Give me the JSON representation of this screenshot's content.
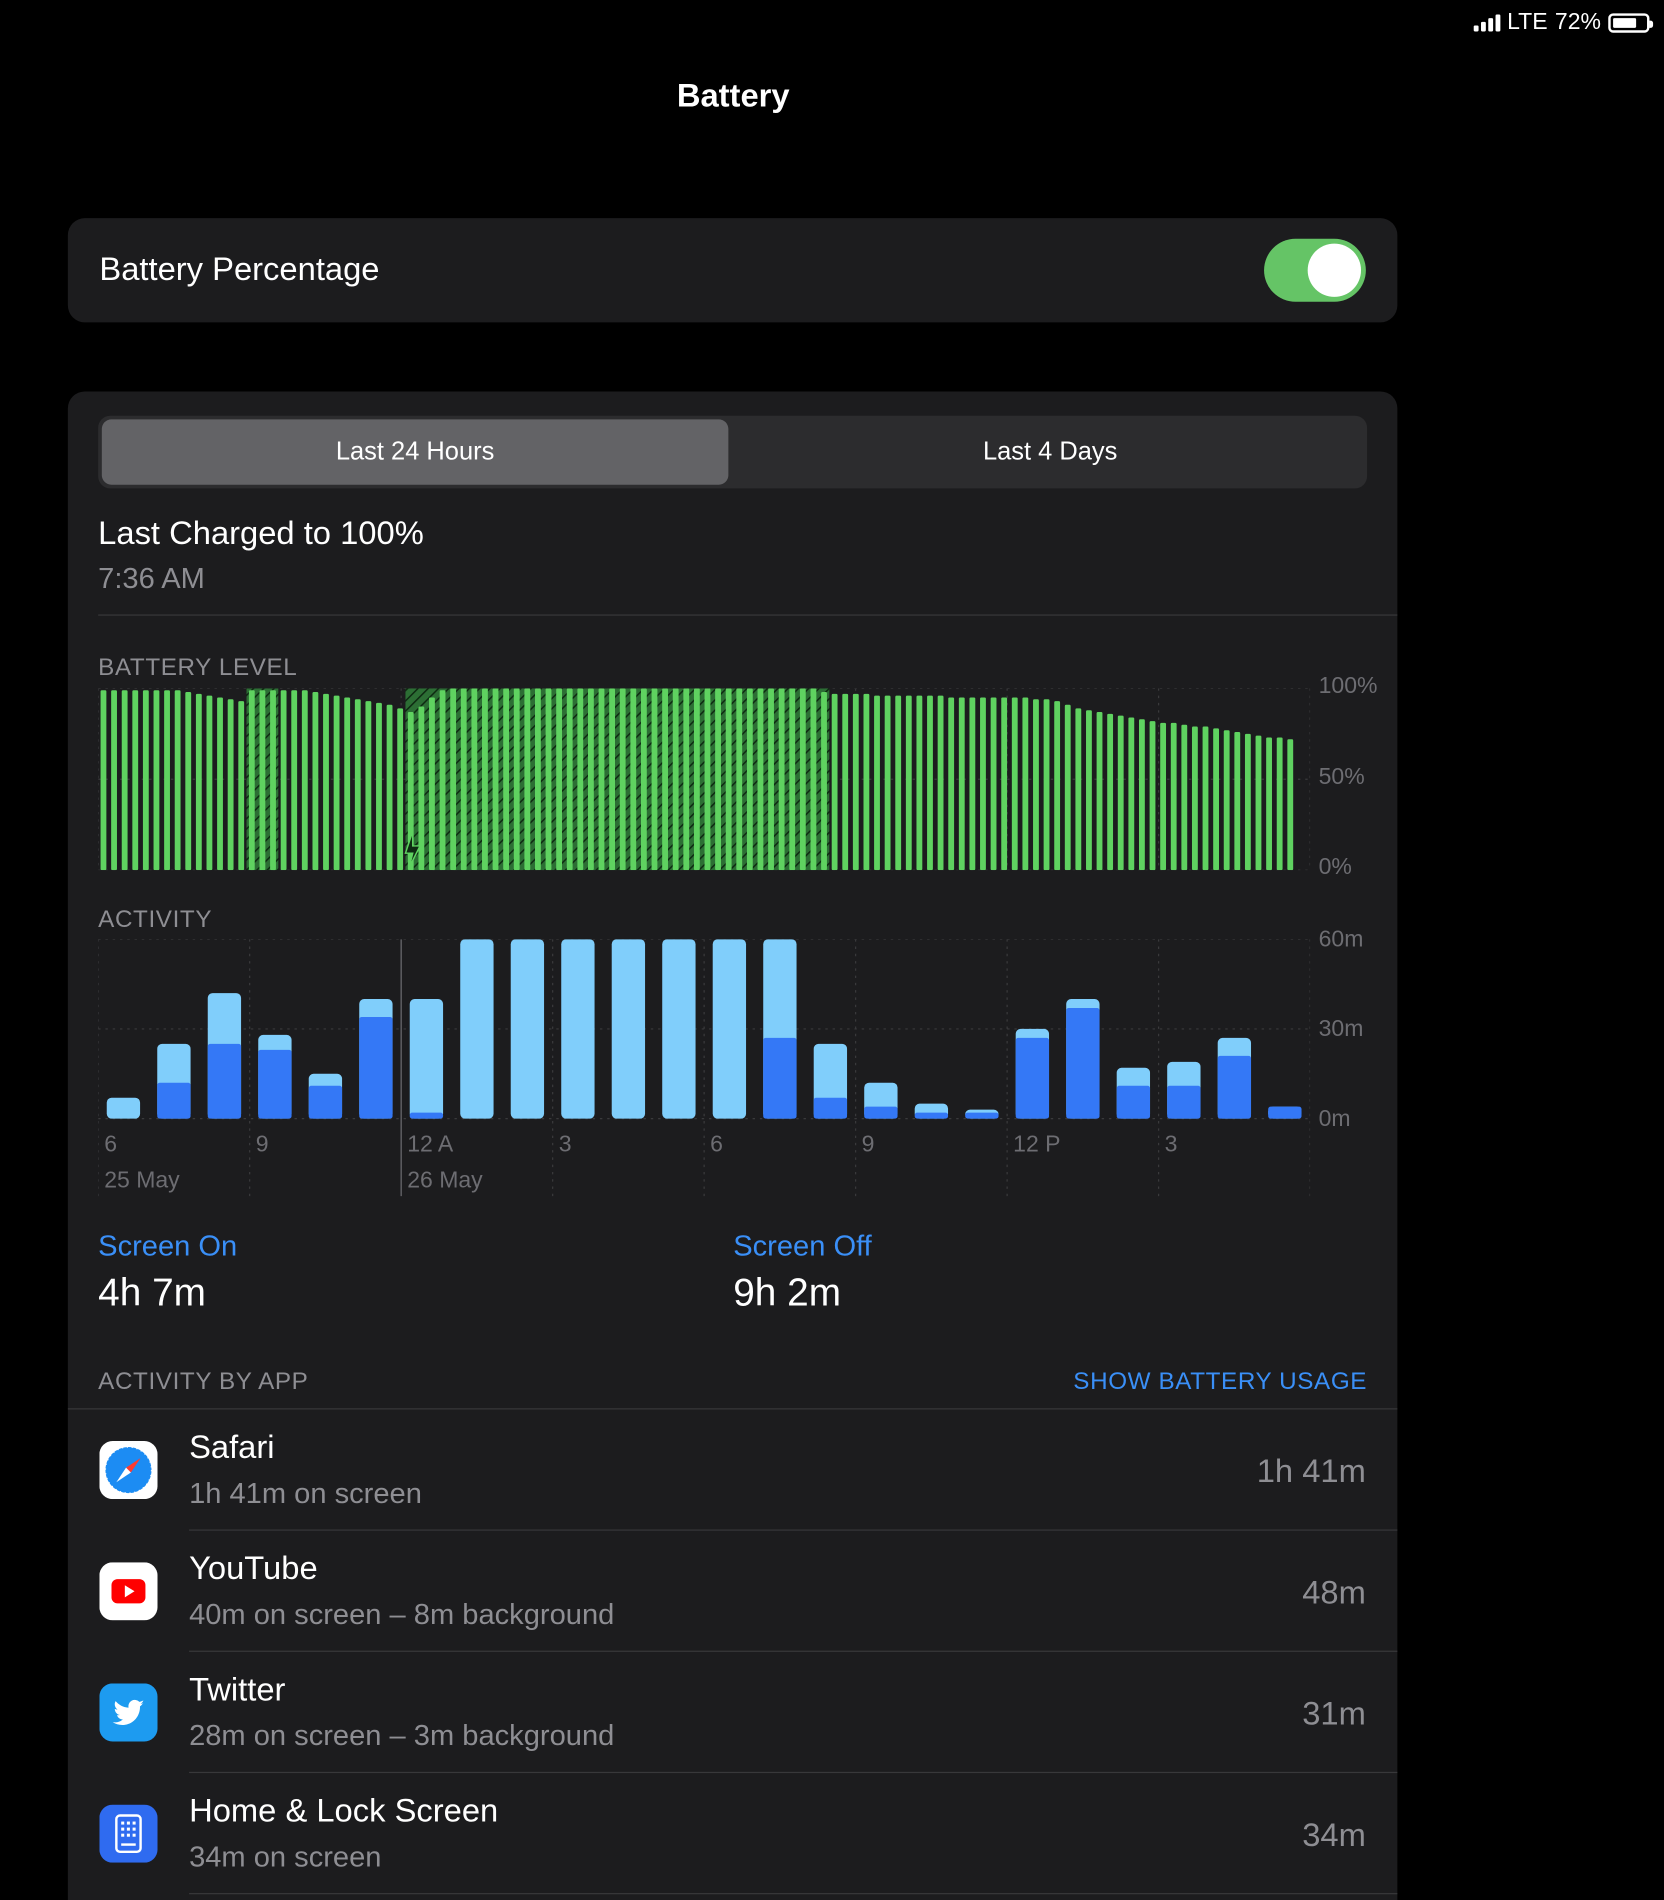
{
  "status_bar": {
    "network": "LTE",
    "battery_percent": "72%",
    "battery_level": 0.72
  },
  "page_title": "Battery",
  "battery_percentage_toggle": {
    "label": "Battery Percentage",
    "on": true,
    "color": "#65c466"
  },
  "segmented_control": {
    "options": [
      "Last 24 Hours",
      "Last 4 Days"
    ],
    "selected": "Last 24 Hours"
  },
  "last_charged": {
    "label": "Last Charged to 100%",
    "time": "7:36 AM"
  },
  "battery_level_section": {
    "label": "BATTERY LEVEL",
    "y_ticks": [
      "100%",
      "50%",
      "0%"
    ]
  },
  "activity_section": {
    "label": "ACTIVITY",
    "y_ticks": [
      "60m",
      "30m",
      "0m"
    ],
    "x_ticks": [
      "6",
      "9",
      "12 A",
      "3",
      "6",
      "9",
      "12 P",
      "3"
    ],
    "dates": [
      "25 May",
      "26 May"
    ]
  },
  "chart_data": [
    {
      "type": "bar",
      "title": "BATTERY LEVEL",
      "ylim": [
        0,
        100
      ],
      "y_unit": "%",
      "x_ticks": [
        "6",
        "9",
        "12 A",
        "3",
        "6",
        "9",
        "12 P",
        "3"
      ],
      "values": [
        99,
        99,
        99,
        99,
        99,
        99,
        99,
        99,
        98,
        97,
        96,
        95,
        94,
        93,
        99,
        99,
        99,
        99,
        99,
        99,
        98,
        97,
        96,
        95,
        94,
        93,
        92,
        91,
        89,
        87,
        90,
        95,
        99,
        100,
        100,
        100,
        100,
        100,
        100,
        100,
        100,
        100,
        100,
        100,
        100,
        100,
        100,
        100,
        100,
        100,
        100,
        100,
        100,
        100,
        100,
        100,
        100,
        100,
        100,
        100,
        100,
        100,
        100,
        100,
        100,
        100,
        100,
        100,
        98,
        97,
        97,
        97,
        97,
        96,
        96,
        96,
        96,
        96,
        96,
        96,
        95,
        95,
        95,
        95,
        95,
        95,
        95,
        95,
        94,
        94,
        93,
        91,
        89,
        88,
        87,
        86,
        85,
        84,
        83,
        82,
        81,
        81,
        80,
        79,
        79,
        78,
        77,
        76,
        75,
        74,
        73,
        73,
        72
      ],
      "charging_ranges": [
        [
          14,
          16
        ],
        [
          29,
          68
        ]
      ]
    },
    {
      "type": "bar",
      "title": "ACTIVITY",
      "ylim": [
        0,
        60
      ],
      "y_unit": "m",
      "categories": [
        "6",
        "7",
        "8",
        "9",
        "10",
        "11",
        "12 A",
        "1",
        "2",
        "3",
        "4",
        "5",
        "6",
        "7",
        "8",
        "9",
        "10",
        "11",
        "12 P",
        "1",
        "2",
        "3",
        "4",
        "5"
      ],
      "series": [
        {
          "name": "Screen On",
          "color": "#3478f6",
          "values": [
            0,
            12,
            25,
            23,
            11,
            34,
            2,
            0,
            0,
            0,
            0,
            0,
            0,
            27,
            7,
            4,
            2,
            2,
            27,
            37,
            11,
            11,
            21,
            4
          ]
        },
        {
          "name": "Screen Off",
          "color": "#80cefb",
          "values": [
            7,
            13,
            17,
            5,
            4,
            6,
            38,
            60,
            60,
            60,
            60,
            60,
            60,
            33,
            18,
            8,
            3,
            1,
            3,
            3,
            6,
            8,
            6,
            0
          ]
        }
      ]
    }
  ],
  "screen_on": {
    "label": "Screen On",
    "value": "4h 7m"
  },
  "screen_off": {
    "label": "Screen Off",
    "value": "9h 2m"
  },
  "activity_by_app": {
    "label": "ACTIVITY BY APP",
    "action": "SHOW BATTERY USAGE",
    "apps": [
      {
        "name": "Safari",
        "detail": "1h 41m on screen",
        "total": "1h 41m",
        "icon": "safari-icon"
      },
      {
        "name": "YouTube",
        "detail": "40m on screen – 8m background",
        "total": "48m",
        "icon": "youtube-icon"
      },
      {
        "name": "Twitter",
        "detail": "28m on screen – 3m background",
        "total": "31m",
        "icon": "twitter-icon"
      },
      {
        "name": "Home & Lock Screen",
        "detail": "34m on screen",
        "total": "34m",
        "icon": "home-lock-screen-icon"
      }
    ]
  }
}
